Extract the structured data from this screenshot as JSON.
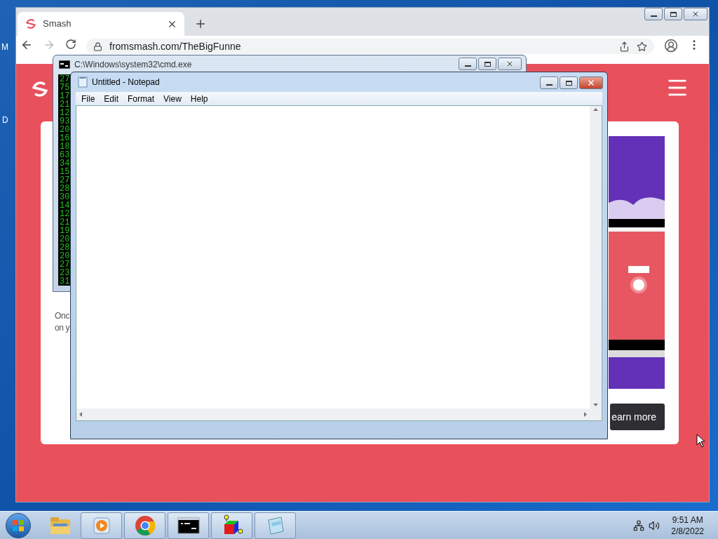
{
  "desktop": {
    "icon_labels": [
      "M",
      "D"
    ]
  },
  "browser": {
    "tabs": [
      {
        "title": "Smash",
        "selected": true
      }
    ],
    "url": "fromsmash.com/TheBigFunne",
    "page": {
      "card_text": [
        "Onc",
        "on y"
      ],
      "button": "earn more"
    }
  },
  "cmd": {
    "title": "C:\\Windows\\system32\\cmd.exe",
    "lines": [
      "27",
      "75",
      "17",
      "21",
      "12",
      "93",
      "20",
      "16",
      "18",
      "63",
      "34",
      "15",
      "27",
      "28",
      "30",
      "14",
      "12",
      "21",
      "19",
      "20",
      "28",
      "20",
      "27",
      "23",
      "31"
    ]
  },
  "notepad": {
    "title": "Untitled - Notepad",
    "menu": [
      "File",
      "Edit",
      "Format",
      "View",
      "Help"
    ]
  },
  "taskbar": {
    "apps": [
      {
        "kind": "explorer",
        "running": false
      },
      {
        "kind": "media",
        "running": true
      },
      {
        "kind": "chrome",
        "running": true
      },
      {
        "kind": "cmd",
        "running": true
      },
      {
        "kind": "cube",
        "running": true
      },
      {
        "kind": "notepad",
        "running": true
      }
    ],
    "clock": {
      "time": "9:51 AM",
      "date": "2/8/2022"
    }
  }
}
